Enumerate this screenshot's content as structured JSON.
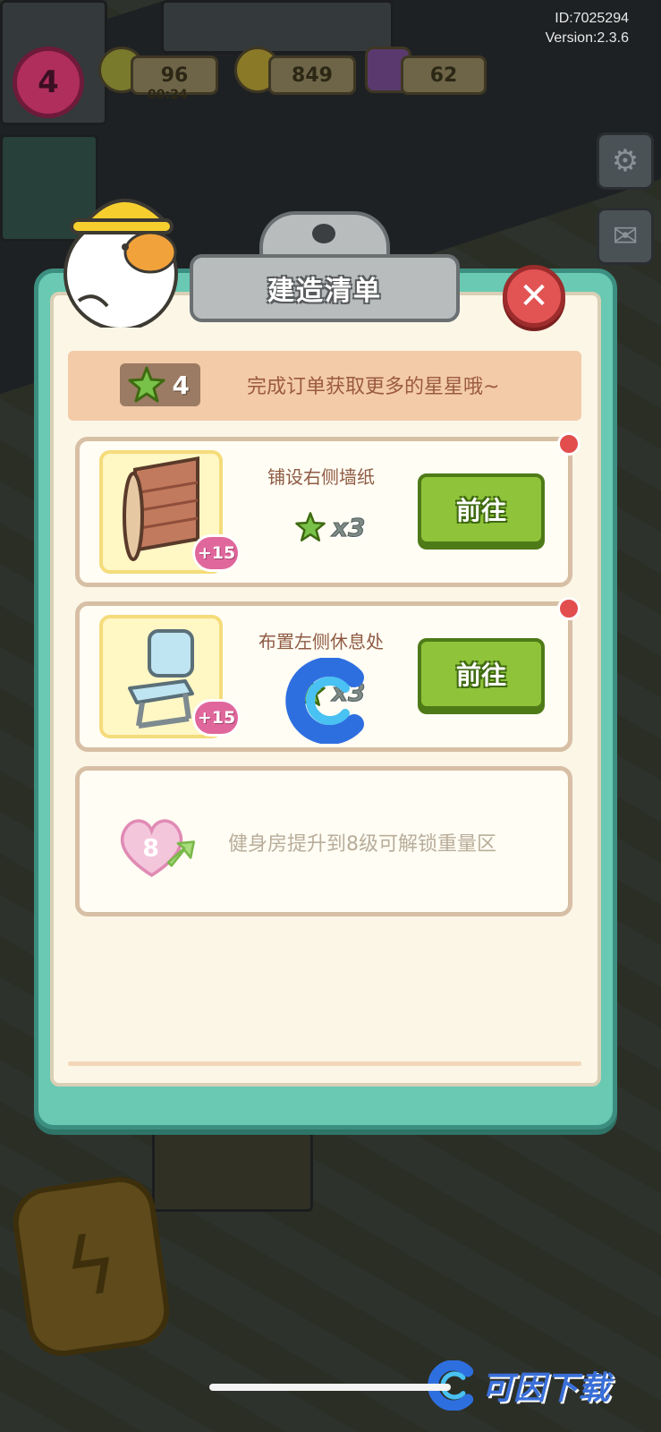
{
  "hud": {
    "id_text": "ID:7025294",
    "version_text": "Version:2.3.6",
    "level": "4",
    "energy": "96",
    "energy_timer": "00:24",
    "coins": "849",
    "gems": "62"
  },
  "panel": {
    "title": "建造清单",
    "star_count": "4",
    "banner_text": "完成订单获取更多的星星哦~"
  },
  "tasks": [
    {
      "title": "铺设右侧墙纸",
      "reward": "x3",
      "bonus": "+15",
      "button_label": "前往",
      "thumb_icon": "wallpaper-roll-icon"
    },
    {
      "title": "布置左侧休息处",
      "reward": "x3",
      "bonus": "+15",
      "button_label": "前往",
      "thumb_icon": "chair-icon"
    }
  ],
  "locked": {
    "level": "8",
    "text": "健身房提升到8级可解锁重量区"
  },
  "watermark": {
    "text": "可因下载"
  },
  "colors": {
    "board": "#69c9b3",
    "paper": "#fbf6e6",
    "banner": "#f3cba8",
    "go_button": "#8fc33a",
    "close_button": "#e25454",
    "bonus_badge": "#e0679c",
    "star": "#79c24a"
  }
}
